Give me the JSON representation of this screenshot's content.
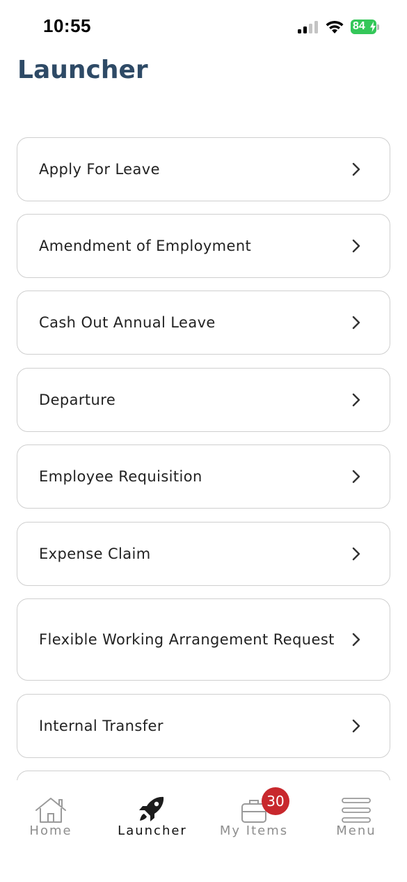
{
  "status_bar": {
    "time": "10:55",
    "battery_percent": "84",
    "battery_level": 0.84,
    "signal_bars_active": 2,
    "signal_bars_total": 4
  },
  "page": {
    "title": "Launcher"
  },
  "launcher_items": [
    {
      "label": "Apply For Leave"
    },
    {
      "label": "Amendment of Employment"
    },
    {
      "label": "Cash Out Annual Leave"
    },
    {
      "label": "Departure"
    },
    {
      "label": "Employee Requisition"
    },
    {
      "label": "Expense Claim"
    },
    {
      "label": "Flexible Working Arrangement Request"
    },
    {
      "label": "Internal Transfer"
    },
    {
      "label": ""
    }
  ],
  "tab_bar": {
    "tabs": [
      {
        "label": "Home",
        "icon": "house-icon",
        "active": false
      },
      {
        "label": "Launcher",
        "icon": "rocket-icon",
        "active": true
      },
      {
        "label": "My Items",
        "icon": "briefcase-icon",
        "active": false,
        "badge": "30"
      },
      {
        "label": "Menu",
        "icon": "hamburger-menu-icon",
        "active": false
      }
    ]
  },
  "colors": {
    "title": "#2e4a66",
    "badge": "#c8282d",
    "battery": "#34c759",
    "inactive_tab": "#8e8e8e"
  }
}
